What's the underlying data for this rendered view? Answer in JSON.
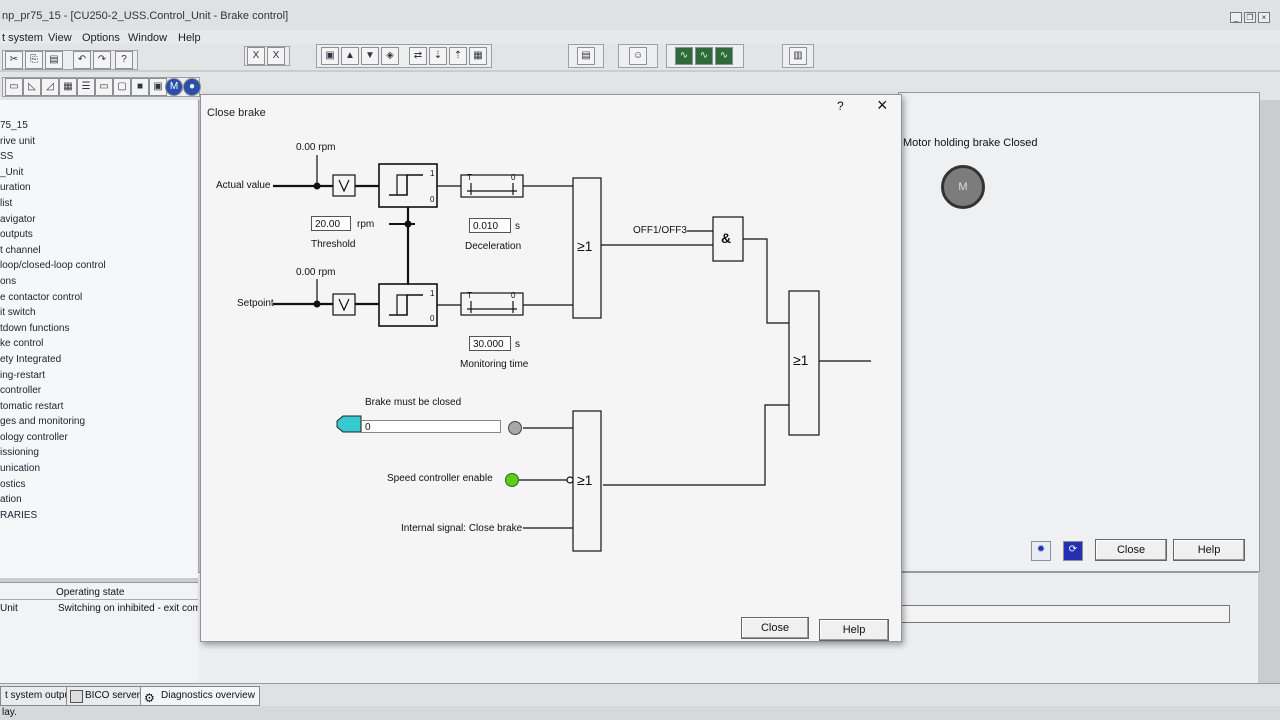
{
  "window": {
    "title": "np_pr75_15 - [CU250-2_USS.Control_Unit - Brake control]",
    "minimize": "_",
    "restore": "❐",
    "close": "×"
  },
  "menu": {
    "items": [
      "t system",
      "View",
      "Options",
      "Window",
      "Help"
    ]
  },
  "tree": {
    "items": [
      "75_15",
      "rive unit",
      "SS",
      "_Unit",
      "uration",
      "list",
      "avigator",
      "outputs",
      "t channel",
      "loop/closed-loop control",
      "ons",
      "e contactor control",
      "it switch",
      "tdown functions",
      "ke control",
      "ety Integrated",
      "ing-restart",
      "controller",
      "tomatic restart",
      "ges and monitoring",
      "ology controller",
      "issioning",
      "unication",
      "ostics",
      "ation",
      "RARIES"
    ]
  },
  "state_table": {
    "header": "Operating state",
    "row_name": "Unit",
    "row_value": "Switching on inhibited - exit commis"
  },
  "right_panel": {
    "brake_label": "Motor holding brake Closed",
    "motor_letter": "M",
    "close_label": "Close",
    "help_label": "Help"
  },
  "dialog": {
    "title": "Close brake",
    "help_glyph": "?",
    "close_glyph": "×",
    "actual_value_label": "Actual value",
    "actual_rpm": "0.00 rpm",
    "threshold_value": "20.00",
    "threshold_unit": "rpm",
    "threshold_label": "Threshold",
    "setpoint_label": "Setpoint",
    "setpoint_rpm": "0.00 rpm",
    "deceleration_value": "0.010",
    "deceleration_unit": "s",
    "deceleration_label": "Deceleration",
    "monitoring_value": "30.000",
    "monitoring_unit": "s",
    "monitoring_label": "Monitoring time",
    "or_gate": "≥1",
    "and_gate": "&",
    "off_label": "OFF1/OFF3",
    "brake_must_label": "Brake must be closed",
    "brake_must_value": "0",
    "speed_enable_label": "Speed controller enable",
    "internal_signal_label": "Internal signal: Close brake",
    "timer_T": "T",
    "timer_0": "0",
    "comp_1": "1",
    "comp_0": "0",
    "close_label": "Close",
    "help_label": "Help"
  },
  "tabs": {
    "system_output": "t system output",
    "bico": "BICO server",
    "diagnostics": "Diagnostics overview"
  },
  "status": {
    "text": "lay."
  },
  "colors": {
    "lamp_green": "#5ccc1f",
    "lamp_gray": "#a8a8a8",
    "connector_cyan": "#36c9cf",
    "motor_gray": "#7c7c7c"
  }
}
